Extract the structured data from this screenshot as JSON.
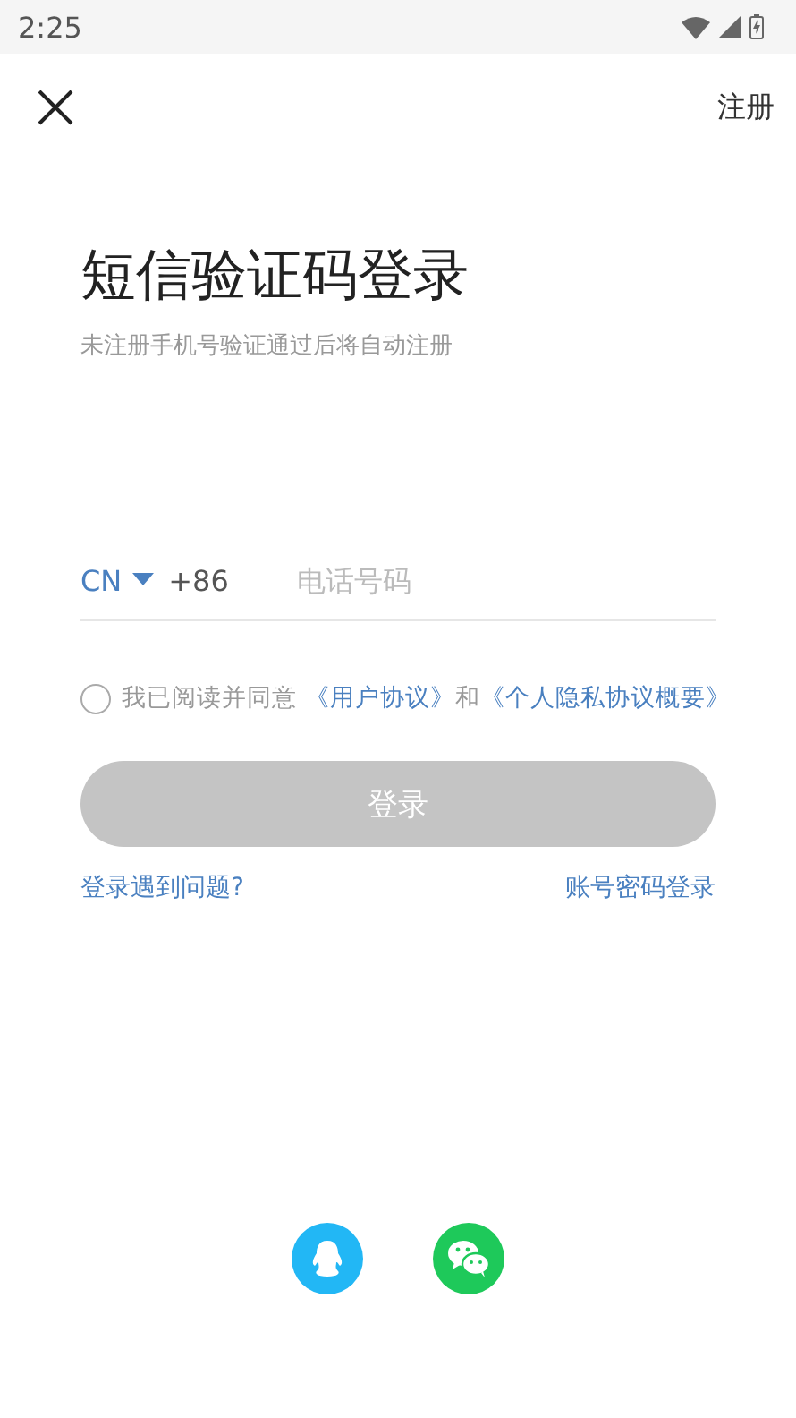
{
  "status_bar": {
    "time": "2:25"
  },
  "top_bar": {
    "action": "注册"
  },
  "title": "短信验证码登录",
  "subtitle": "未注册手机号验证通过后将自动注册",
  "phone": {
    "region": "CN",
    "code": "+86",
    "placeholder": "电话号码"
  },
  "agreement": {
    "checked": false,
    "text": "我已阅读并同意",
    "links": [
      "《用户协议》",
      "《个人隐私协议概要》"
    ],
    "joiner": "和"
  },
  "login_button": {
    "label": "登录",
    "disabled": true
  },
  "links": [
    "登录遇到问题?",
    "账号密码登录"
  ],
  "social": [
    {
      "kind": "qq"
    },
    {
      "kind": "wechat"
    }
  ]
}
